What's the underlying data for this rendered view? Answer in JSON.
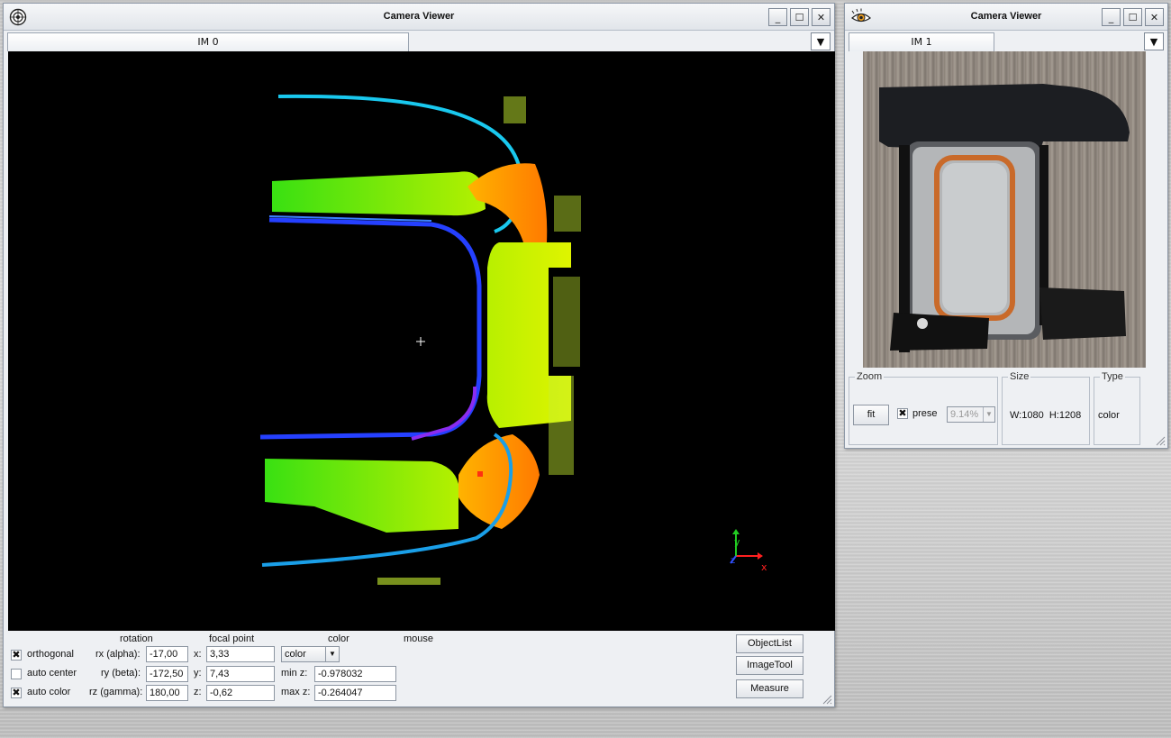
{
  "window_main": {
    "title": "Camera Viewer",
    "tab": "IM 0",
    "controls": {
      "headers": {
        "rotation": "rotation",
        "focal_point": "focal point",
        "color": "color",
        "mouse": "mouse"
      },
      "orthogonal": {
        "label": "orthogonal",
        "checked": "✖"
      },
      "auto_center": {
        "label": "auto center",
        "checked": ""
      },
      "auto_color": {
        "label": "auto color",
        "checked": "✖"
      },
      "rx": {
        "label": "rx (alpha):",
        "value": "-17,00"
      },
      "ry": {
        "label": "ry (beta):",
        "value": "-172,50"
      },
      "rz": {
        "label": "rz (gamma):",
        "value": "180,00"
      },
      "fx": {
        "label": "x:",
        "value": "3,33"
      },
      "fy": {
        "label": "y:",
        "value": "7,43"
      },
      "fz": {
        "label": "z:",
        "value": "-0,62"
      },
      "color_select": "color",
      "min_z": {
        "label": "min z:",
        "value": "-0.978032"
      },
      "max_z": {
        "label": "max z:",
        "value": "-0.264047"
      }
    },
    "buttons": {
      "object_list": "ObjectList",
      "image_tool": "ImageTool",
      "measure": "Measure"
    },
    "axes": {
      "x": "x",
      "y": "y",
      "z": "z"
    }
  },
  "window_side": {
    "title": "Camera Viewer",
    "tab": "IM 1",
    "zoom": {
      "title": "Zoom",
      "fit": "fit",
      "preset_label": "prese",
      "preset_checked": "✖",
      "zoom_value": "9.14%"
    },
    "size": {
      "title": "Size",
      "value": "W:1080  H:1208"
    },
    "type": {
      "title": "Type",
      "value": "color"
    }
  },
  "icons": [
    "settings-icon",
    "eye-icon",
    "minimize-icon",
    "maximize-icon",
    "close-icon",
    "dropdown-arrow-icon",
    "crosshair-icon",
    "resize-grip-icon"
  ],
  "colors": {
    "viewport_bg": "#000000",
    "titlebar": "#e8ebef",
    "axis_x": "#ff2020",
    "axis_y": "#22cc22",
    "axis_z": "#3050ff"
  }
}
